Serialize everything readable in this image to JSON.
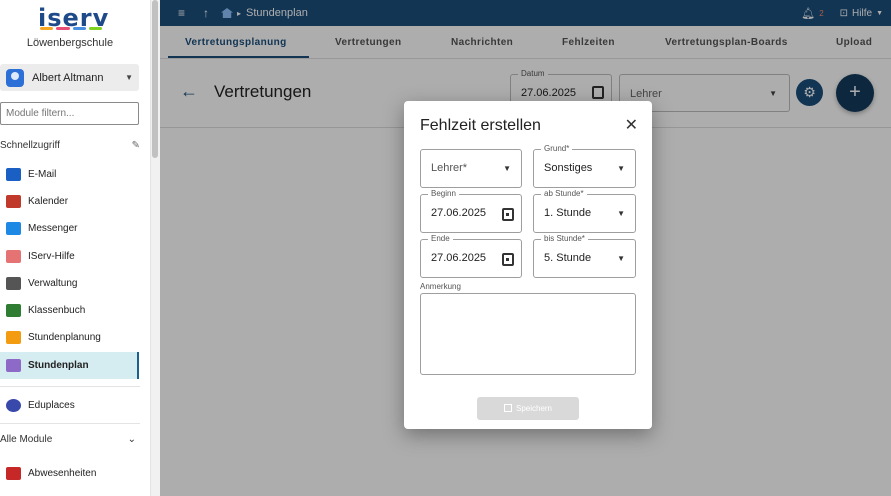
{
  "sidebar": {
    "logo": "iserv",
    "school": "Löwenbergschule",
    "user_name": "Albert Altmann",
    "module_filter_placeholder": "Module filtern...",
    "quick_access_label": "Schnellzugriff",
    "items": [
      {
        "label": "E-Mail",
        "icon": "mail-icon",
        "color": "#1a5fc4"
      },
      {
        "label": "Kalender",
        "icon": "calendar-icon",
        "color": "#c0392b"
      },
      {
        "label": "Messenger",
        "icon": "messenger-icon",
        "color": "#1e88e5"
      },
      {
        "label": "IServ-Hilfe",
        "icon": "help-icon",
        "color": "#e57373"
      },
      {
        "label": "Verwaltung",
        "icon": "gear-icon",
        "color": "#555555"
      },
      {
        "label": "Klassenbuch",
        "icon": "book-icon",
        "color": "#2e7d32"
      },
      {
        "label": "Stundenplanung",
        "icon": "planning-icon",
        "color": "#f39c12"
      },
      {
        "label": "Stundenplan",
        "icon": "timetable-icon",
        "color": "#8e6ac8"
      }
    ],
    "eduplaces": {
      "label": "Eduplaces",
      "icon": "eduplaces-icon",
      "color": "#3949ab"
    },
    "all_modules_label": "Alle Module",
    "absences": {
      "label": "Abwesenheiten",
      "icon": "absence-icon",
      "color": "#c62828"
    }
  },
  "topbar": {
    "breadcrumb": "Stundenplan",
    "notification_count": "2",
    "help_label": "Hilfe"
  },
  "tabs": [
    "Vertretungsplanung",
    "Vertretungen",
    "Nachrichten",
    "Fehlzeiten",
    "Vertretungsplan-Boards",
    "Upload"
  ],
  "page": {
    "title": "Vertretungen",
    "date_label": "Datum",
    "date_value": "27.06.2025",
    "teacher_placeholder": "Lehrer"
  },
  "dialog": {
    "title": "Fehlzeit erstellen",
    "teacher_placeholder": "Lehrer*",
    "reason_label": "Grund*",
    "reason_value": "Sonstiges",
    "begin_label": "Beginn",
    "begin_value": "27.06.2025",
    "from_lesson_label": "ab Stunde*",
    "from_lesson_value": "1. Stunde",
    "end_label": "Ende",
    "end_value": "27.06.2025",
    "to_lesson_label": "bis Stunde*",
    "to_lesson_value": "5. Stunde",
    "note_label": "Anmerkung",
    "save_label": "Speichern"
  }
}
